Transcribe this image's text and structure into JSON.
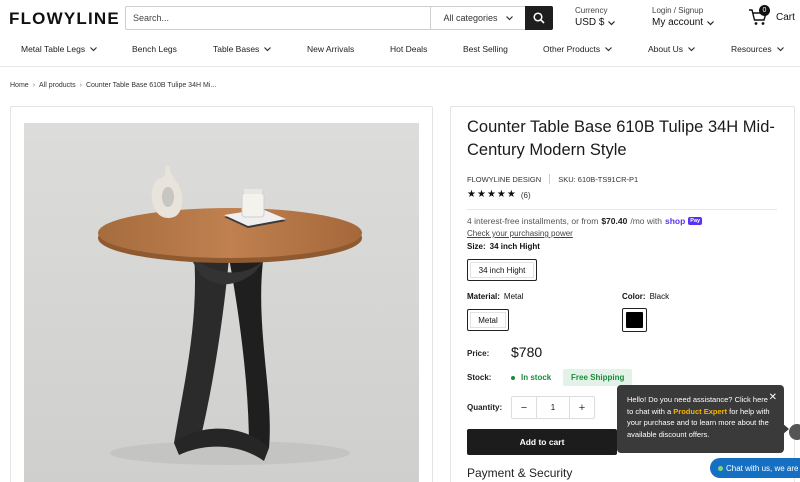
{
  "header": {
    "logo": "FLOWYLINE",
    "search_placeholder": "Search...",
    "category": "All categories",
    "currency_label": "Currency",
    "currency_value": "USD $",
    "login_label": "Login / Signup",
    "account_label": "My account",
    "cart_label": "Cart",
    "cart_count": "0"
  },
  "nav": [
    {
      "label": "Metal Table Legs",
      "chevron": true
    },
    {
      "label": "Bench Legs",
      "chevron": false
    },
    {
      "label": "Table Bases",
      "chevron": true
    },
    {
      "label": "New Arrivals",
      "chevron": false
    },
    {
      "label": "Hot Deals",
      "chevron": false
    },
    {
      "label": "Best Selling",
      "chevron": false
    },
    {
      "label": "Other Products",
      "chevron": true
    },
    {
      "label": "About Us",
      "chevron": true
    },
    {
      "label": "Resources",
      "chevron": true
    }
  ],
  "breadcrumb": [
    "Home",
    "All products",
    "Counter Table Base 610B Tulipe 34H Mi..."
  ],
  "product": {
    "title": "Counter Table Base 610B Tulipe 34H Mid-Century Modern Style",
    "vendor": "FLOWYLINE DESIGN",
    "sku": "SKU: 610B-TS91CR-P1",
    "rating": 5,
    "review_count": "(6)",
    "installments_text": "4 interest-free installments, or from",
    "installments_amount": "$70.40",
    "installments_suffix": "/mo with",
    "shop_pay": "shop",
    "shop_pay_badge": "Pay",
    "eligibility": "Check your purchasing power",
    "size_label": "Size:",
    "size_value": "34 inch Hight",
    "size_option": "34 inch Hight",
    "material_label": "Material:",
    "material_value": "Metal",
    "material_option": "Metal",
    "color_label": "Color:",
    "color_value": "Black",
    "color_swatch": "#000000",
    "price_label": "Price:",
    "price": "$780",
    "stock_label": "Stock:",
    "stock_value": "In stock",
    "free_shipping": "Free Shipping",
    "quantity_label": "Quantity:",
    "quantity": "1",
    "add_to_cart": "Add to cart",
    "payment_security": "Payment & Security"
  },
  "popup": {
    "text_1": "Hello! Do you need assistance? Click here to chat with a",
    "highlight": "Product Expert",
    "text_2": "for help with your purchase and to learn more about the available discount offers."
  },
  "chat": {
    "label": "Chat with us, we are"
  },
  "colors": {
    "accent": "#1c1c1c",
    "in_stock": "#1c8a3c",
    "shop_pay": "#5a31f4",
    "chat": "#1570c4",
    "popup_highlight": "#f4b400"
  }
}
